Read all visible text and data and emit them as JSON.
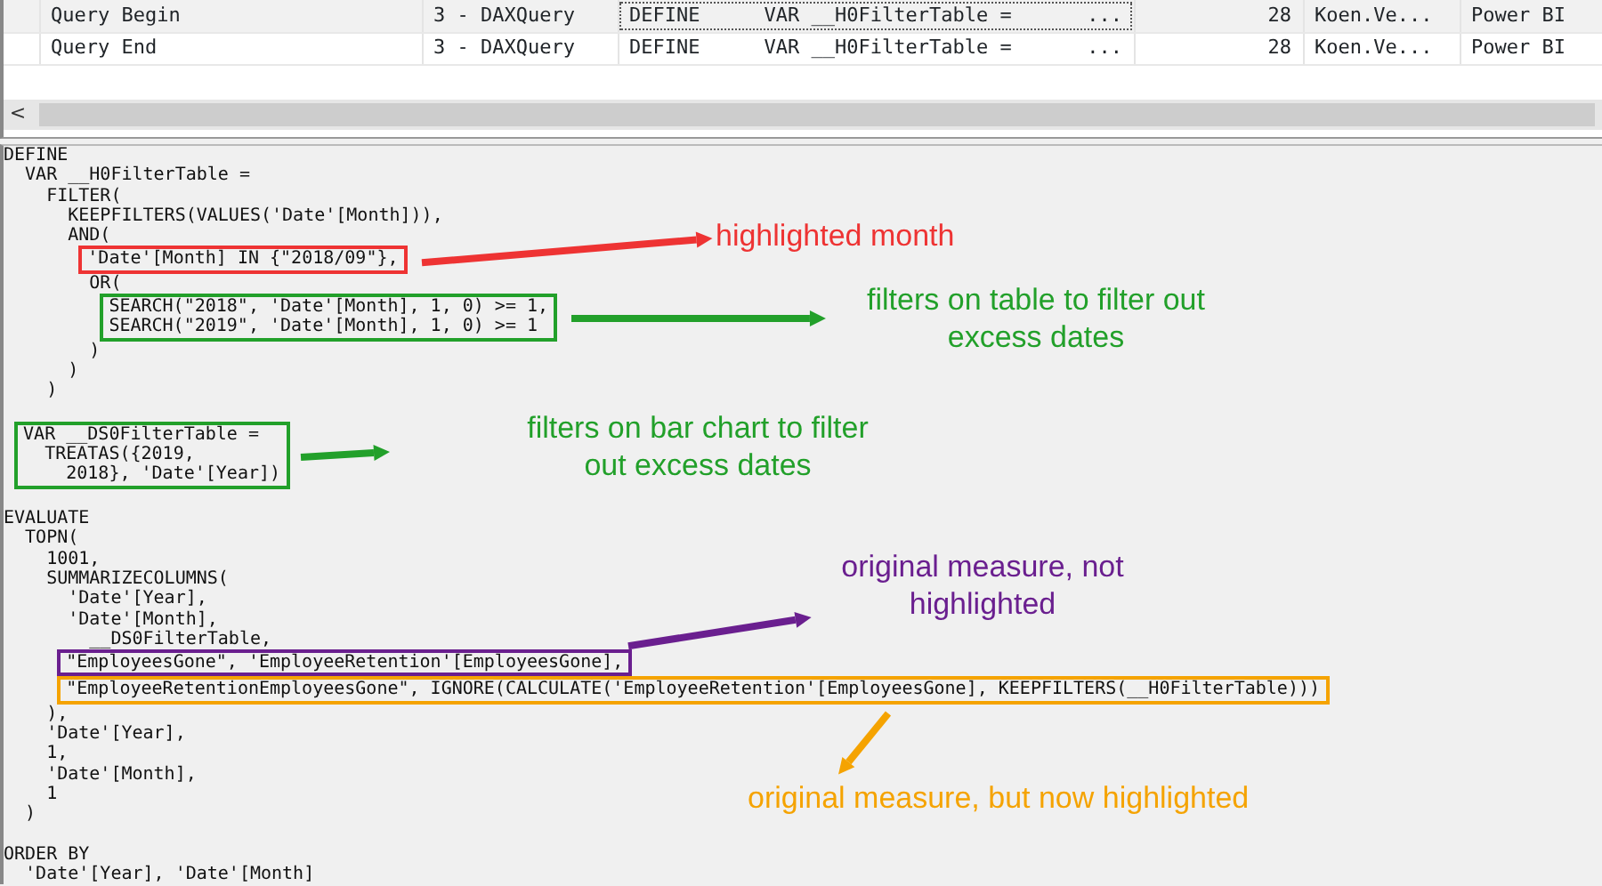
{
  "trace_rows": [
    {
      "event_class": "Query Begin",
      "event_subclass": "3 - DAXQuery",
      "text_data": [
        "DEFINE",
        "VAR __H0FilterTable =",
        "..."
      ],
      "duration": "28",
      "user": "Koen.Ve...",
      "application": "Power BI",
      "selected": true
    },
    {
      "event_class": "Query End",
      "event_subclass": "3 - DAXQuery",
      "text_data": [
        "DEFINE",
        "VAR __H0FilterTable =",
        "..."
      ],
      "duration": "28",
      "user": "Koen.Ve...",
      "application": "Power BI",
      "selected": false
    }
  ],
  "scrollbar": {
    "left_arrow": "<"
  },
  "code_blocks": [
    {
      "lines": [
        "DEFINE",
        "  VAR __H0FilterTable =",
        "    FILTER(",
        "      KEEPFILTERS(VALUES('Date'[Month])),",
        "      AND("
      ]
    },
    {
      "color": "#ee3333",
      "lines": [
        "        'Date'[Month] IN {\"2018/09\"},"
      ]
    },
    {
      "lines": [
        "        OR("
      ]
    },
    {
      "color": "#22a02a",
      "lines": [
        "          SEARCH(\"2018\", 'Date'[Month], 1, 0) >= 1,",
        "          SEARCH(\"2019\", 'Date'[Month], 1, 0) >= 1"
      ]
    },
    {
      "lines": [
        "        )",
        "      )",
        "    )"
      ],
      "space_after": true
    },
    {
      "color": "#22a02a",
      "lines": [
        "  VAR __DS0FilterTable =",
        "    TREATAS({2019,",
        "      2018}, 'Date'[Year])"
      ],
      "space_after": true
    },
    {
      "lines": [
        "EVALUATE",
        "  TOPN(",
        "    1001,",
        "    SUMMARIZECOLUMNS(",
        "      'Date'[Year],",
        "      'Date'[Month],",
        "        __DS0FilterTable,"
      ]
    },
    {
      "color": "#6a1f8f",
      "lines": [
        "      \"EmployeesGone\", 'EmployeeRetention'[EmployeesGone],"
      ]
    },
    {
      "color": "#f5a300",
      "lines": [
        "      \"EmployeeRetentionEmployeesGone\", IGNORE(CALCULATE('EmployeeRetention'[EmployeesGone], KEEPFILTERS(__H0FilterTable)))"
      ]
    },
    {
      "lines": [
        "    ),",
        "    'Date'[Year],",
        "    1,",
        "    'Date'[Month],",
        "    1",
        "  )"
      ],
      "space_after": true
    },
    {
      "lines": [
        "ORDER BY",
        "  'Date'[Year], 'Date'[Month]"
      ]
    }
  ],
  "annotations": [
    {
      "text": "highlighted month",
      "color": "#ee3333"
    },
    {
      "text": "filters on table to filter out excess dates",
      "color": "#22a02a"
    },
    {
      "text": "filters on bar chart to filter out excess dates",
      "color": "#22a02a"
    },
    {
      "text": "original measure, not highlighted",
      "color": "#6a1f8f"
    },
    {
      "text": "original measure, but now highlighted",
      "color": "#f5a300"
    }
  ]
}
